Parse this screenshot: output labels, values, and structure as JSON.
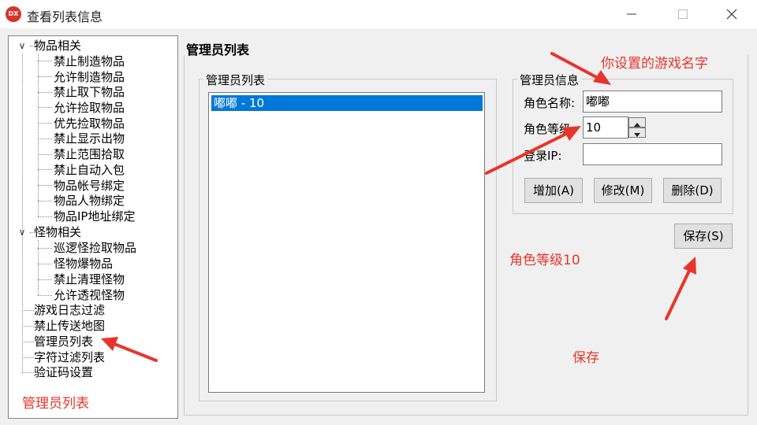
{
  "window": {
    "icon_text": "DX",
    "title": "查看列表信息"
  },
  "tree": {
    "groups": [
      {
        "label": "物品相关",
        "expanded": true,
        "children": [
          "禁止制造物品",
          "允许制造物品",
          "禁止取下物品",
          "允许捡取物品",
          "优先捡取物品",
          "禁止显示出物",
          "禁止范围拾取",
          "禁止自动入包",
          "物品帐号绑定",
          "物品人物绑定",
          "物品IP地址绑定"
        ]
      },
      {
        "label": "怪物相关",
        "expanded": true,
        "children": [
          "巡逻怪捡取物品",
          "怪物爆物品",
          "禁止清理怪物",
          "允许透视怪物"
        ]
      }
    ],
    "items": [
      "游戏日志过滤",
      "禁止传送地图",
      "管理员列表",
      "字符过滤列表",
      "验证码设置"
    ]
  },
  "main": {
    "title": "管理员列表",
    "list_group_label": "管理员列表",
    "list_items": [
      "嘟嘟 - 10"
    ],
    "info_group_label": "管理员信息",
    "role_name_label": "角色名称:",
    "role_name_value": "嘟嘟",
    "role_level_label": "角色等级:",
    "role_level_value": "10",
    "login_ip_label": "登录IP:",
    "login_ip_value": "",
    "add_button": "增加(A)",
    "edit_button": "修改(M)",
    "delete_button": "删除(D)",
    "save_button": "保存(S)"
  },
  "annotations": {
    "game_name_note": "你设置的游戏名字",
    "level_note": "角色等级10",
    "save_note": "保存",
    "admin_list_note": "管理员列表",
    "color": "#e8352b"
  }
}
